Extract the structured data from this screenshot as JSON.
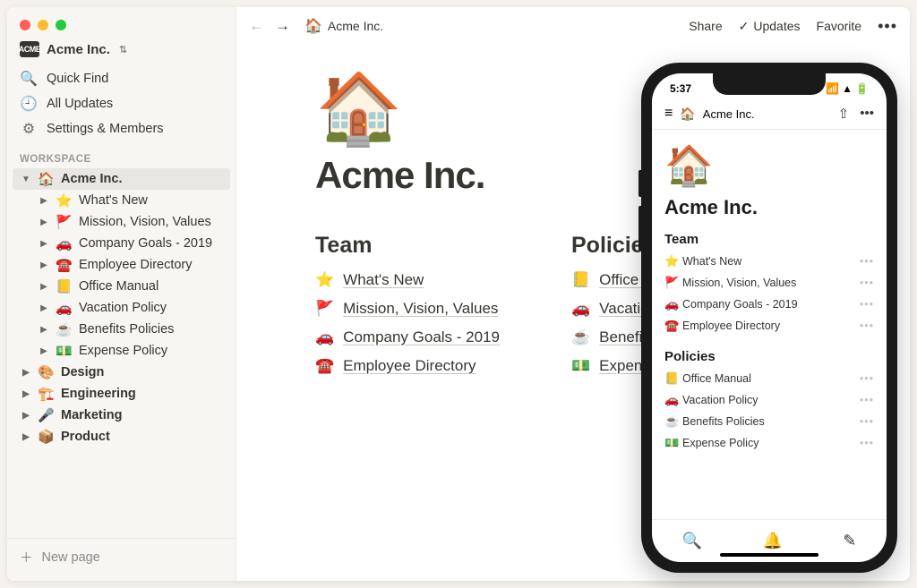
{
  "workspace": {
    "badge": "ACME",
    "name": "Acme Inc."
  },
  "sidebar": {
    "quick_find": "Quick Find",
    "all_updates": "All Updates",
    "settings": "Settings & Members",
    "section_label": "WORKSPACE",
    "new_page": "New page",
    "root": {
      "icon": "🏠",
      "label": "Acme Inc."
    },
    "children": [
      {
        "icon": "⭐",
        "label": "What's New"
      },
      {
        "icon": "🚩",
        "label": "Mission, Vision, Values"
      },
      {
        "icon": "🚗",
        "label": "Company Goals - 2019"
      },
      {
        "icon": "☎️",
        "label": "Employee Directory"
      },
      {
        "icon": "📒",
        "label": "Office Manual"
      },
      {
        "icon": "🚗",
        "label": "Vacation Policy"
      },
      {
        "icon": "☕",
        "label": "Benefits Policies"
      },
      {
        "icon": "💵",
        "label": "Expense Policy"
      }
    ],
    "others": [
      {
        "icon": "🎨",
        "label": "Design"
      },
      {
        "icon": "🏗️",
        "label": "Engineering"
      },
      {
        "icon": "🎤",
        "label": "Marketing"
      },
      {
        "icon": "📦",
        "label": "Product"
      }
    ]
  },
  "topbar": {
    "breadcrumb_icon": "🏠",
    "breadcrumb": "Acme Inc.",
    "share": "Share",
    "updates": "Updates",
    "favorite": "Favorite"
  },
  "page": {
    "icon": "🏠",
    "title": "Acme Inc.",
    "columns": [
      {
        "heading": "Team",
        "links": [
          {
            "icon": "⭐",
            "label": "What's New"
          },
          {
            "icon": "🚩",
            "label": "Mission, Vision, Values"
          },
          {
            "icon": "🚗",
            "label": "Company Goals - 2019"
          },
          {
            "icon": "☎️",
            "label": "Employee Directory"
          }
        ]
      },
      {
        "heading": "Policies",
        "links": [
          {
            "icon": "📒",
            "label": "Office Manual"
          },
          {
            "icon": "🚗",
            "label": "Vacation Policy"
          },
          {
            "icon": "☕",
            "label": "Benefits Policies"
          },
          {
            "icon": "💵",
            "label": "Expense Policy"
          }
        ]
      }
    ]
  },
  "phone": {
    "time": "5:37",
    "header_icon": "🏠",
    "header_title": "Acme Inc.",
    "page_icon": "🏠",
    "page_title": "Acme Inc.",
    "sections": [
      {
        "heading": "Team",
        "items": [
          {
            "icon": "⭐",
            "label": "What's New"
          },
          {
            "icon": "🚩",
            "label": "Mission, Vision, Values"
          },
          {
            "icon": "🚗",
            "label": "Company Goals - 2019"
          },
          {
            "icon": "☎️",
            "label": "Employee Directory"
          }
        ]
      },
      {
        "heading": "Policies",
        "items": [
          {
            "icon": "📒",
            "label": "Office Manual"
          },
          {
            "icon": "🚗",
            "label": "Vacation Policy"
          },
          {
            "icon": "☕",
            "label": "Benefits Policies"
          },
          {
            "icon": "💵",
            "label": "Expense Policy"
          }
        ]
      }
    ]
  }
}
